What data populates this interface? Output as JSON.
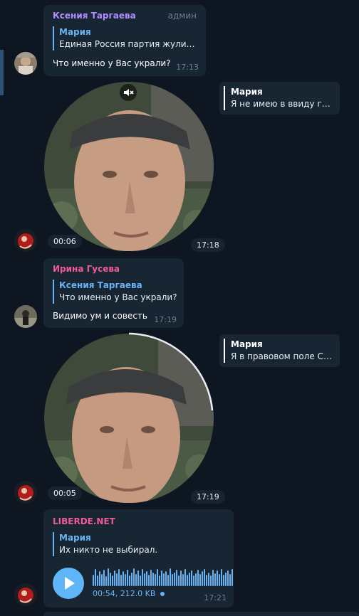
{
  "colors": {
    "background": "#0e1621",
    "bubble": "#182533",
    "accent_blue": "#6ab3f3",
    "name_purple": "#b38dff",
    "name_pink": "#ee5a9b",
    "muted": "#6d7f8f"
  },
  "messages": {
    "m1": {
      "sender": "Ксения Таргаева",
      "role": "админ",
      "reply_name": "Мария",
      "reply_text": "Единая Россия партия жулик…",
      "text": "Что именно у Вас украли?",
      "time": "17:13"
    },
    "v1": {
      "reply_name": "Мария",
      "reply_text": "Я не имею в ввиду гр…",
      "duration": "00:06",
      "time": "17:18",
      "muted_icon": "speaker-muted-icon"
    },
    "m2": {
      "sender": "Ирина Гусева",
      "reply_name": "Ксения Таргаева",
      "reply_text": "Что именно у Вас украли?",
      "text": "Видимо ум и совесть",
      "time": "17:19"
    },
    "v2": {
      "reply_name": "Мария",
      "reply_text": "Я в правовом поле С…",
      "duration": "00:05",
      "time": "17:19"
    },
    "m3": {
      "sender": "LIBERDE.NET",
      "reply_name": "Мария",
      "reply_text": "Их никто не выбирал.",
      "voice_meta": "00:54, 212.0 KB",
      "time": "17:21",
      "play_icon": "play-icon"
    }
  },
  "waveform_levels": [
    0.55,
    0.9,
    0.5,
    0.75,
    0.6,
    0.85,
    0.45,
    0.95,
    0.7,
    0.5,
    0.8,
    0.65,
    0.9,
    0.55,
    0.75,
    0.6,
    0.85,
    0.5,
    0.7,
    0.95,
    0.6,
    0.8,
    0.5,
    0.9,
    0.65,
    0.75,
    0.55,
    0.85,
    0.7,
    0.6,
    0.9,
    0.5,
    0.8,
    0.65,
    0.75,
    0.55,
    0.95,
    0.6,
    0.7,
    0.85,
    0.5,
    0.8,
    0.6,
    0.9,
    0.55,
    0.7,
    0.8,
    0.5,
    0.65,
    0.85,
    0.6,
    0.75,
    0.9,
    0.55,
    0.7,
    0.5,
    0.85,
    0.65,
    0.8,
    0.6,
    0.9,
    0.55,
    0.7,
    0.8,
    0.6,
    0.9
  ]
}
